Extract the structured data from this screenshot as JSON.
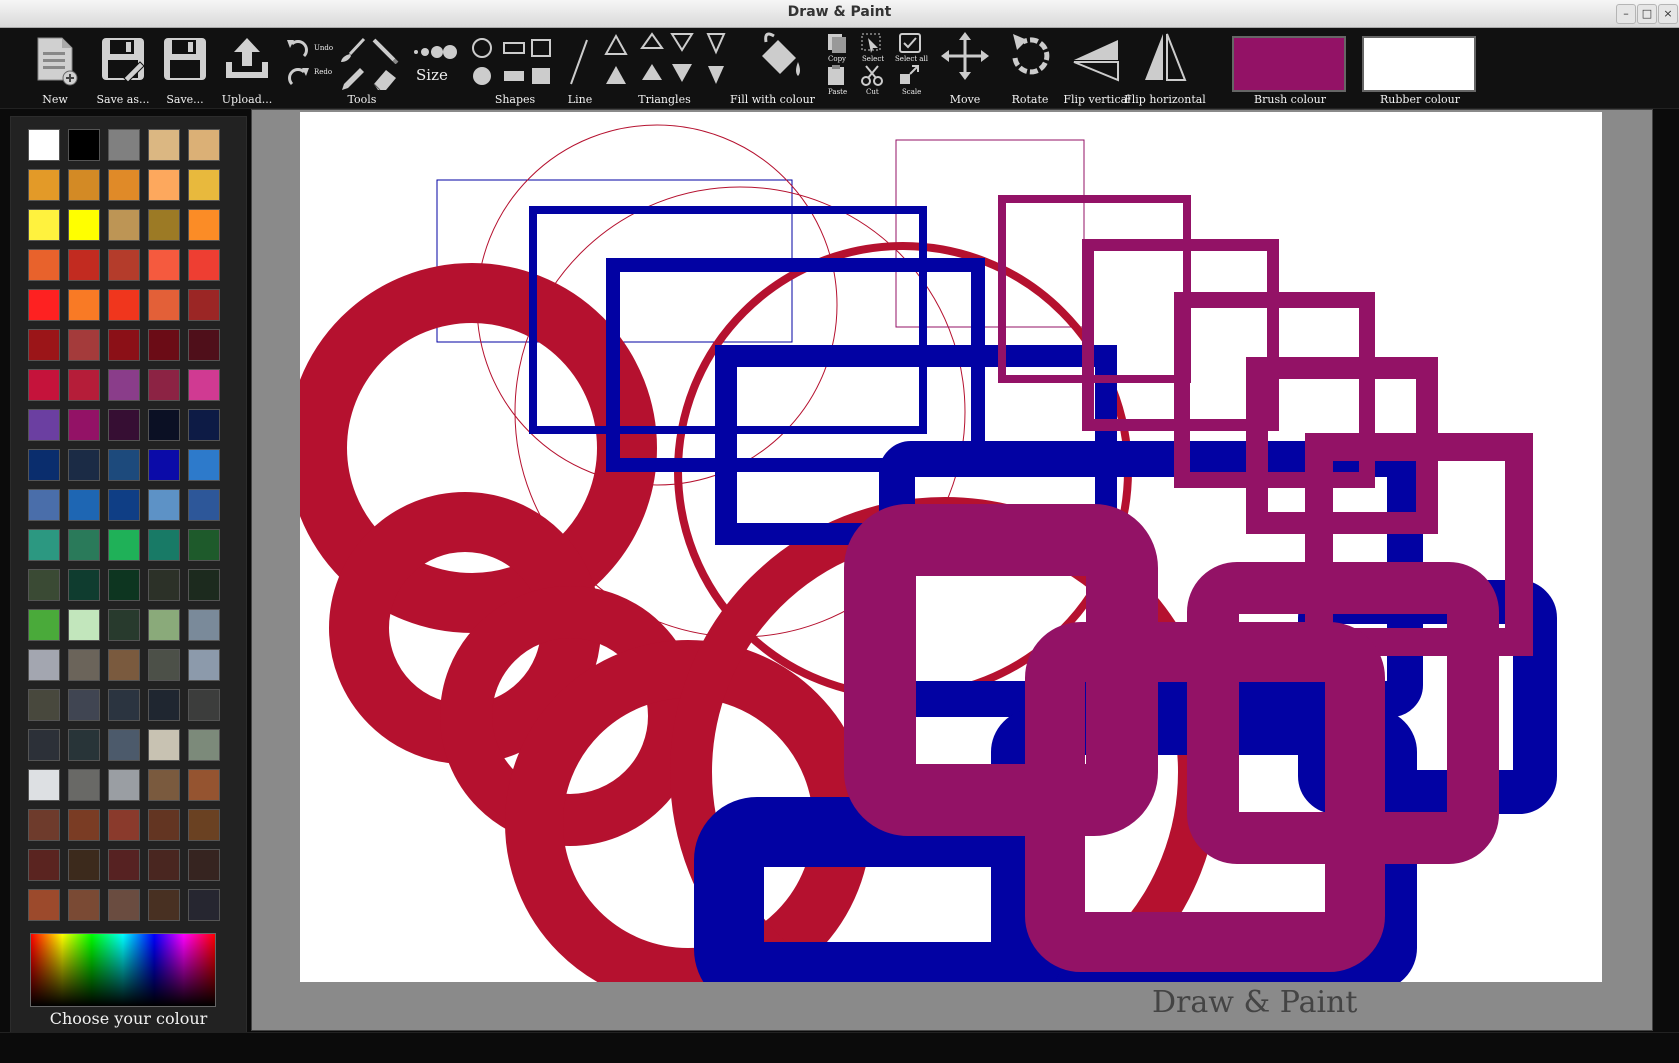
{
  "window": {
    "title": "Draw & Paint",
    "min_glyph": "–",
    "max_glyph": "□",
    "close_glyph": "×"
  },
  "toolbar": {
    "new": "New",
    "save_as": "Save as...",
    "save": "Save...",
    "upload": "Upload...",
    "undo": "Undo",
    "redo": "Redo",
    "tools": "Tools",
    "size": "Size",
    "shapes": "Shapes",
    "line": "Line",
    "triangles": "Triangles",
    "fill": "Fill with colour",
    "copy": "Copy",
    "paste": "Paste",
    "select": "Select",
    "cut": "Cut",
    "select_all": "Select all",
    "scale": "Scale",
    "move": "Move",
    "rotate": "Rotate",
    "flip_vertical": "Flip vertical",
    "flip_horizontal": "Flip horizontal",
    "brush_colour": "Brush colour",
    "rubber_colour": "Rubber colour"
  },
  "colors": {
    "brush": "#931266",
    "rubber": "#ffffff",
    "red": "#b5112f",
    "blue": "#0202a3",
    "purple": "#931266"
  },
  "palette": {
    "rows": [
      [
        "#ffffff",
        "#000000",
        "#808080",
        "#dbb782",
        "#dbb076"
      ],
      [
        "#e39a28",
        "#d38a25",
        "#e08a28",
        "#fda85d",
        "#e8b93d"
      ],
      [
        "#fff23e",
        "#ffff00",
        "#bd9555",
        "#9c7a25",
        "#fb8c26"
      ],
      [
        "#e8622c",
        "#c22b20",
        "#b43c2b",
        "#f55a3e",
        "#ee3e32"
      ],
      [
        "#fe2121",
        "#f97a25",
        "#f0361d",
        "#e36038",
        "#9b2625"
      ],
      [
        "#9b1518",
        "#a43b3b",
        "#8b1017",
        "#6b0c16",
        "#4f0f1a"
      ],
      [
        "#c5133b",
        "#b51d39",
        "#8a3d8a",
        "#8c2344",
        "#d03a92"
      ],
      [
        "#6b3fa1",
        "#931266",
        "#360e33",
        "#0b1024",
        "#0d1b45"
      ],
      [
        "#0a2d6d",
        "#1b2b45",
        "#1d4a7c",
        "#0b0ba8",
        "#2d7acb"
      ],
      [
        "#4a6eaa",
        "#1e66b3",
        "#0f3e85",
        "#5d92c6",
        "#2d5799"
      ],
      [
        "#2c9881",
        "#2a7a5a",
        "#1fb158",
        "#187a66",
        "#1e5a2b"
      ],
      [
        "#3a4a34",
        "#0f3c2f",
        "#0d3520",
        "#2c3128",
        "#1c2a1e"
      ],
      [
        "#4aaa3a",
        "#c2e6bc",
        "#283a2d",
        "#8aaa7a",
        "#7a8a9a"
      ],
      [
        "#a3a6b0",
        "#6b645a",
        "#7a5a3e",
        "#4c5048",
        "#8c9aab"
      ],
      [
        "#48483d",
        "#404552",
        "#2b3440",
        "#1f2630",
        "#3c3d3c"
      ],
      [
        "#2c3038",
        "#283438",
        "#4c5a6b",
        "#c8c2b2",
        "#7c8a7a"
      ],
      [
        "#dde0e3",
        "#696966",
        "#9a9ea3",
        "#7a5a3e",
        "#955430"
      ],
      [
        "#6e3b2c",
        "#7a3c24",
        "#8a3a2c",
        "#633522",
        "#6a4122"
      ],
      [
        "#5a2420",
        "#3c2a1c",
        "#562222",
        "#492620",
        "#362420"
      ],
      [
        "#9c4a2c",
        "#7a4a34",
        "#6a4c40",
        "#483022",
        "#262630"
      ]
    ],
    "choose_label": "Choose your colour"
  },
  "canvas": {
    "watermark": "Draw & Paint"
  }
}
